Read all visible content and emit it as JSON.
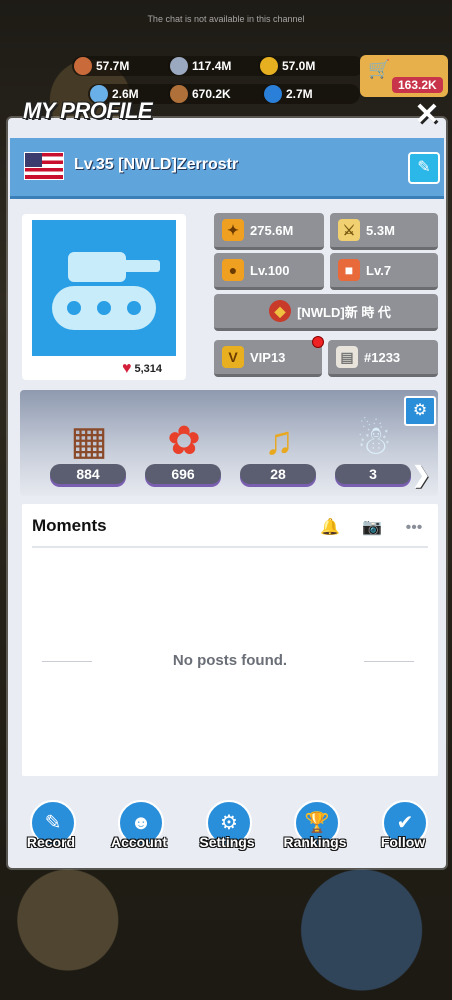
{
  "notice": "The chat is not available in this channel",
  "resources": [
    {
      "value": "57.7M",
      "color": "#c86a3a",
      "icon": "food-icon"
    },
    {
      "value": "117.4M",
      "color": "#9aa8c0",
      "icon": "steel-icon"
    },
    {
      "value": "57.0M",
      "color": "#e6b020",
      "icon": "gold-coin-icon"
    },
    {
      "value": "2.6M",
      "color": "#6ab0e8",
      "icon": "gem-icon"
    },
    {
      "value": "670.2K",
      "color": "#b0703a",
      "icon": "wood-icon"
    },
    {
      "value": "2.7M",
      "color": "#2a7fd8",
      "icon": "fuel-icon"
    }
  ],
  "shop": {
    "amount": "163.2K"
  },
  "profile": {
    "title": "MY PROFILE",
    "player": "Lv.35 [NWLD]Zerrostr",
    "likes": "5,314",
    "stats": {
      "power": "275.6M",
      "kills": "5.3M",
      "commander_level": "Lv.100",
      "gift_level": "Lv.7",
      "alliance": "[NWLD]新 時 代",
      "vip": "VIP13",
      "server": "#1233"
    }
  },
  "items": [
    {
      "count": "884",
      "icon": "chocolate-gift-icon"
    },
    {
      "count": "696",
      "icon": "flower-bouquet-icon"
    },
    {
      "count": "28",
      "icon": "music-note-icon"
    },
    {
      "count": "3",
      "icon": "snowman-icon"
    }
  ],
  "moments": {
    "title": "Moments",
    "empty": "No posts found."
  },
  "nav": [
    {
      "label": "Record",
      "icon": "record-icon"
    },
    {
      "label": "Account",
      "icon": "account-icon"
    },
    {
      "label": "Settings",
      "icon": "settings-icon"
    },
    {
      "label": "Rankings",
      "icon": "trophy-icon"
    },
    {
      "label": "Follow",
      "icon": "follow-icon"
    }
  ]
}
